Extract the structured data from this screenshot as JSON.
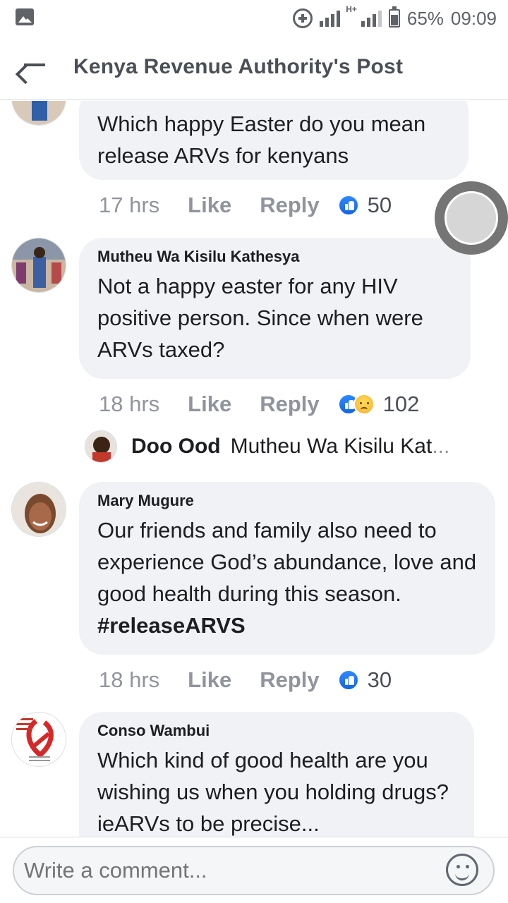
{
  "status_bar": {
    "network_type": "H+",
    "battery": "65%",
    "time": "09:09"
  },
  "header": {
    "title": "Kenya Revenue Authority's Post"
  },
  "comments": [
    {
      "author": "",
      "text": "Which happy Easter do you mean release ARVs for kenyans",
      "time": "17 hrs",
      "like_label": "Like",
      "reply_label": "Reply",
      "reactions": [
        "like-icon"
      ],
      "reaction_count": "50"
    },
    {
      "author": "Mutheu Wa Kisilu Kathesya",
      "text": "Not a happy easter for any HIV positive person. Since when were ARVs taxed?",
      "time": "18 hrs",
      "like_label": "Like",
      "reply_label": "Reply",
      "reactions": [
        "like-icon",
        "sad-icon"
      ],
      "reaction_count": "102"
    },
    {
      "author": "Mary Mugure",
      "text": "Our friends and family also need to experience God’s abundance, love and good health during this season.",
      "hashtag": "#releaseARVS",
      "time": "18 hrs",
      "like_label": "Like",
      "reply_label": "Reply",
      "reactions": [
        "like-icon"
      ],
      "reaction_count": "30"
    },
    {
      "author": "Conso Wambui",
      "text": "Which kind of good health are you wishing us when  you holding drugs?ieARVs to be precise..."
    }
  ],
  "reply_preview": {
    "author": "Doo Ood",
    "text": "Mutheu Wa Kisilu Kat",
    "ellipsis": "..."
  },
  "composer": {
    "placeholder": "Write a comment..."
  },
  "colors": {
    "bubble": "#f0f2f5",
    "meta_text": "#90949c",
    "like_blue": "#1877f2"
  }
}
